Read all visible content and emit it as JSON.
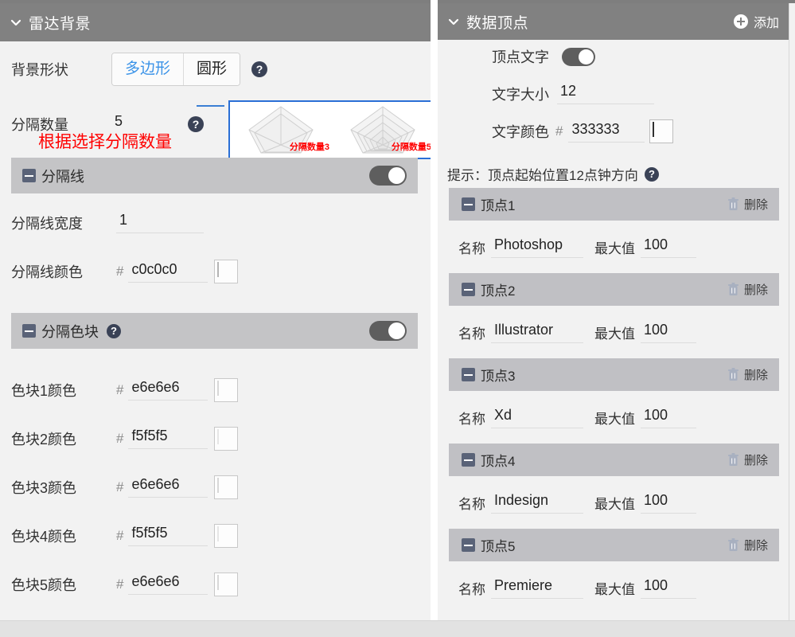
{
  "left_panel": {
    "header": {
      "title": "雷达背景",
      "chevron_icon": "chevron-down-icon"
    },
    "shape_row": {
      "label": "背景形状",
      "options": [
        "多边形",
        "圆形"
      ],
      "selected": "多边形",
      "help_icon": "help-icon"
    },
    "segment_count_row": {
      "label": "分隔数量",
      "value": "5",
      "help_icon": "help-icon"
    },
    "warning_text": "根据选择分隔数量",
    "preview": {
      "thumb1_caption": "分隔数量3",
      "thumb2_caption": "分隔数量5",
      "thumb1_rings": 3,
      "thumb2_rings": 5,
      "border_color": "#2a6fd6"
    },
    "divider_section": {
      "title": "分隔线",
      "collapse_icon": "minus-box-icon",
      "toggle_on": true,
      "width_row": {
        "label": "分隔线宽度",
        "value": "1"
      },
      "color_row": {
        "label": "分隔线颜色",
        "hash": "#",
        "value": "c0c0c0",
        "swatch_color": "#c0c0c0"
      }
    },
    "block_section": {
      "title": "分隔色块",
      "collapse_icon": "minus-box-icon",
      "help_icon": "help-icon",
      "toggle_on": true,
      "colors": [
        {
          "label": "色块1颜色",
          "hash": "#",
          "value": "e6e6e6",
          "swatch_color": "#e6e6e6"
        },
        {
          "label": "色块2颜色",
          "hash": "#",
          "value": "f5f5f5",
          "swatch_color": "#f5f5f5"
        },
        {
          "label": "色块3颜色",
          "hash": "#",
          "value": "e6e6e6",
          "swatch_color": "#e6e6e6"
        },
        {
          "label": "色块4颜色",
          "hash": "#",
          "value": "f5f5f5",
          "swatch_color": "#f5f5f5"
        },
        {
          "label": "色块5颜色",
          "hash": "#",
          "value": "e6e6e6",
          "swatch_color": "#e6e6e6"
        }
      ]
    }
  },
  "right_panel": {
    "header": {
      "title": "数据顶点",
      "chevron_icon": "chevron-down-icon",
      "add_label": "添加",
      "add_icon": "plus-circle-icon"
    },
    "vertex_text_row": {
      "label": "顶点文字",
      "toggle_on": true
    },
    "text_size_row": {
      "label": "文字大小",
      "value": "12"
    },
    "text_color_row": {
      "label": "文字颜色",
      "hash": "#",
      "value": "333333",
      "swatch_color": "#333333"
    },
    "tip": {
      "text": "提示：顶点起始位置12点钟方向",
      "help_icon": "help-icon"
    },
    "vertex_labels": {
      "name": "名称",
      "max": "最大值",
      "delete": "删除",
      "delete_icon": "trash-icon"
    },
    "vertices": [
      {
        "title": "顶点1",
        "name": "Photoshop",
        "max": "100"
      },
      {
        "title": "顶点2",
        "name": "Illustrator",
        "max": "100"
      },
      {
        "title": "顶点3",
        "name": "Xd",
        "max": "100"
      },
      {
        "title": "顶点4",
        "name": "Indesign",
        "max": "100"
      },
      {
        "title": "顶点5",
        "name": "Premiere",
        "max": "100"
      }
    ]
  },
  "theme": {
    "header_bg": "#818181",
    "subheader_bg": "#c4c4c6",
    "panel_bg": "#f2f2f2",
    "accent_blue": "#3b93e8",
    "warn_red": "#ff0000",
    "toggle_on_color": "#5e5e5e"
  }
}
